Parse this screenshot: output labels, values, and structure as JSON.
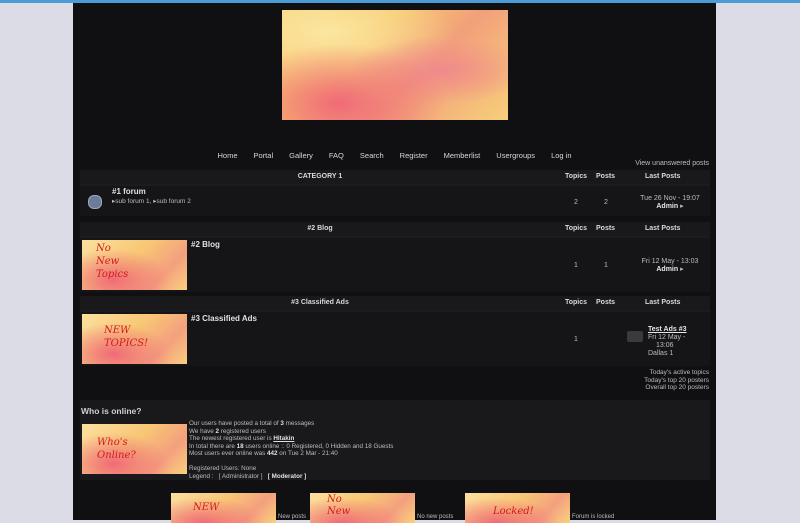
{
  "nav": {
    "items": [
      "Home",
      "Portal",
      "Gallery",
      "FAQ",
      "Search",
      "Register",
      "Memberlist",
      "Usergroups",
      "Log in"
    ],
    "unanswered": "View unanswered posts"
  },
  "headers": {
    "topics": "Topics",
    "posts": "Posts",
    "last_posts": "Last Posts"
  },
  "categories": [
    {
      "title": "CATEGORY 1",
      "forum": {
        "title": "#1 forum",
        "subforums": [
          "sub forum 1,",
          "sub forum 2"
        ],
        "topics": "2",
        "posts": "2",
        "last_date": "Tue 26 Nov - 19:07",
        "last_user": "Admin"
      }
    },
    {
      "title": "#2 Blog",
      "forum": {
        "title": "#2 Blog",
        "image_text": "No New Topics",
        "topics": "1",
        "posts": "1",
        "last_date": "Fri 12 May - 13:03",
        "last_user": "Admin"
      }
    },
    {
      "title": "#3 Classified Ads",
      "forum": {
        "title": "#3 Classified Ads",
        "image_text": "NEW TOPICS!",
        "topics": "1",
        "last_title": "Test Ads #3",
        "last_date1": "Fri 12 May -",
        "last_date2": "13:06",
        "last_user": "Dallas 1"
      }
    }
  ],
  "stats_links": [
    "Today's active topics",
    "Today's top 20 posters",
    "Overall top 20 posters"
  ],
  "who": {
    "title": "Who is online?",
    "image_text": "Who's Online?",
    "l1_a": "Our users have posted a total of ",
    "l1_b": "3",
    "l1_c": " messages",
    "l2_a": "We have ",
    "l2_b": "2",
    "l2_c": " registered users",
    "l3_a": "The newest registered user is ",
    "l3_b": "Hitakin",
    "l4_a": "In total there are ",
    "l4_b": "18",
    "l4_c": " users online :: 0 Registered, 0 Hidden and 18 Guests",
    "l5_a": "Most users ever online was ",
    "l5_b": "442",
    "l5_c": " on Tue 2 Mar - 21:40",
    "l6": "Registered Users: None",
    "l7_a": "Legend :",
    "l7_b": "[ Administrator ]",
    "l7_c": "[ Moderator ]"
  },
  "legend_icons": [
    {
      "image_text": "NEW",
      "label": "New posts"
    },
    {
      "image_text": "No New",
      "label": "No new posts"
    },
    {
      "image_text": "Locked!",
      "label": "Forum is locked"
    }
  ]
}
